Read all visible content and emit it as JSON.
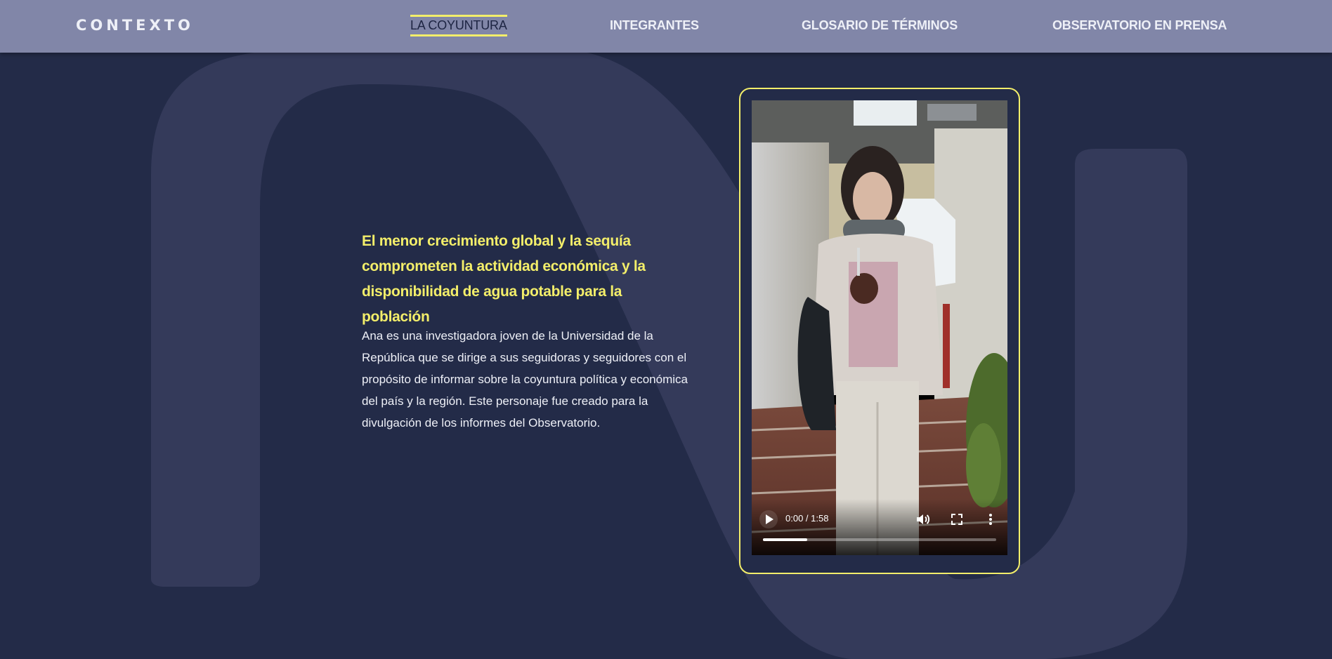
{
  "brand": "CONTEXTO",
  "nav": {
    "items": [
      {
        "id": "coyuntura",
        "label": "LA COYUNTURA",
        "active": true
      },
      {
        "id": "integrantes",
        "label": "INTEGRANTES",
        "active": false
      },
      {
        "id": "glosario",
        "label": "GLOSARIO DE TÉRMINOS",
        "active": false
      },
      {
        "id": "prensa",
        "label": "OBSERVATORIO EN PRENSA",
        "active": false
      }
    ]
  },
  "main": {
    "headline": "El menor crecimiento global y la sequía comprometen la actividad económica y la disponibilidad de agua potable para la población",
    "description": "Ana es una investigadora joven de la Universidad de la República que se dirige a sus seguidoras y seguidores con el propósito de informar sobre la coyuntura política y económica del país y la región. Este personaje fue creado para la divulgación de los informes del Observatorio."
  },
  "video": {
    "time_display": "0:00 / 1:58",
    "buffered_fraction": 0.19,
    "icons": {
      "play": "play-icon",
      "volume": "volume-icon",
      "fullscreen": "fullscreen-icon",
      "more": "more-vertical-icon"
    }
  },
  "colors": {
    "background": "#232b48",
    "navbar": "#8186a8",
    "accent": "#f3ee6a",
    "text_light": "#eef0f7",
    "bg_shape": "#343a5a"
  }
}
